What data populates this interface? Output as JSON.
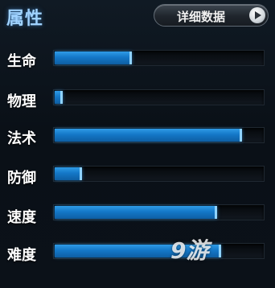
{
  "header": {
    "title": "属性",
    "detail_button_label": "详细数据"
  },
  "stats": [
    {
      "label": "生命",
      "value": 0.37
    },
    {
      "label": "物理",
      "value": 0.04
    },
    {
      "label": "法术",
      "value": 0.9
    },
    {
      "label": "防御",
      "value": 0.13
    },
    {
      "label": "速度",
      "value": 0.78
    },
    {
      "label": "难度",
      "value": 0.8
    }
  ],
  "watermark": "9游",
  "colors": {
    "bar_fill": "#1478c8",
    "title": "#9fd2ff"
  }
}
